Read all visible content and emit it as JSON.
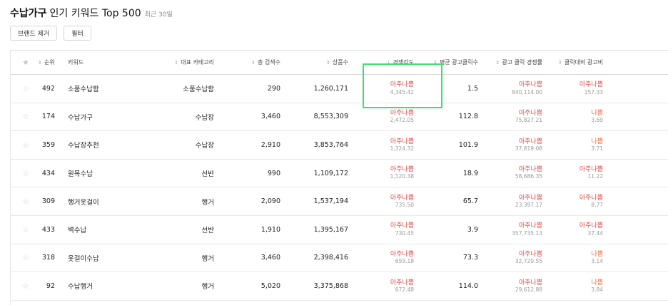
{
  "header": {
    "title_bold": "수납가구",
    "title_rest": "인기 키워드 Top 500",
    "period": "최근 30일"
  },
  "toolbar": {
    "brand_remove": "브랜드 제거",
    "filter": "필터"
  },
  "columns": {
    "star": "★",
    "rank": "순위",
    "keyword": "키워드",
    "category": "대표 카테고리",
    "search_volume": "총 검색수",
    "product_count": "상품수",
    "competition": "경쟁강도",
    "avg_ad_clicks": "평균 광고클릭수",
    "ad_click_competition": "광고 클릭 경쟁률",
    "click_cost": "클릭대비 광고비"
  },
  "icons": {
    "star": "star-outline-icon",
    "sort": "sort-arrows-icon"
  },
  "colors": {
    "very_bad": "#e14b4b",
    "bad": "#f06a3c",
    "highlight": "#3ee06b"
  },
  "rows": [
    {
      "rank": "492",
      "keyword": "소품수납함",
      "category": "소품수납함",
      "volume": "290",
      "products": "1,260,171",
      "comp_label": "아주나쁨",
      "comp_value": "4,345.42",
      "avg_clicks": "1.5",
      "adc_label": "아주나쁨",
      "adc_value": "840,114.00",
      "cost_label": "아주나쁨",
      "cost_value": "157.33",
      "cost_level": "very-bad"
    },
    {
      "rank": "174",
      "keyword": "수납가구",
      "category": "수납장",
      "volume": "3,460",
      "products": "8,553,309",
      "comp_label": "아주나쁨",
      "comp_value": "2,472.05",
      "avg_clicks": "112.8",
      "adc_label": "아주나쁨",
      "adc_value": "75,827.21",
      "cost_label": "나쁨",
      "cost_value": "3.69",
      "cost_level": "bad"
    },
    {
      "rank": "359",
      "keyword": "수납장추천",
      "category": "수납장",
      "volume": "2,910",
      "products": "3,853,764",
      "comp_label": "아주나쁨",
      "comp_value": "1,324.32",
      "avg_clicks": "101.9",
      "adc_label": "아주나쁨",
      "adc_value": "37,819.08",
      "cost_label": "나쁨",
      "cost_value": "3.71",
      "cost_level": "bad"
    },
    {
      "rank": "434",
      "keyword": "원목수납",
      "category": "선반",
      "volume": "990",
      "products": "1,109,172",
      "comp_label": "아주나쁨",
      "comp_value": "1,120.38",
      "avg_clicks": "18.9",
      "adc_label": "아주나쁨",
      "adc_value": "58,686.35",
      "cost_label": "아주나쁨",
      "cost_value": "11.22",
      "cost_level": "very-bad"
    },
    {
      "rank": "309",
      "keyword": "행거옷걸이",
      "category": "행거",
      "volume": "2,090",
      "products": "1,537,194",
      "comp_label": "아주나쁨",
      "comp_value": "735.50",
      "avg_clicks": "65.7",
      "adc_label": "아주나쁨",
      "adc_value": "23,397.17",
      "cost_label": "아주나쁨",
      "cost_value": "8.77",
      "cost_level": "very-bad"
    },
    {
      "rank": "433",
      "keyword": "벽수납",
      "category": "선반",
      "volume": "1,910",
      "products": "1,395,167",
      "comp_label": "아주나쁨",
      "comp_value": "730.45",
      "avg_clicks": "3.9",
      "adc_label": "아주나쁨",
      "adc_value": "357,735.13",
      "cost_label": "아주나쁨",
      "cost_value": "37.44",
      "cost_level": "very-bad"
    },
    {
      "rank": "318",
      "keyword": "옷걸이수납",
      "category": "행거",
      "volume": "3,460",
      "products": "2,398,416",
      "comp_label": "아주나쁨",
      "comp_value": "693.18",
      "avg_clicks": "73.3",
      "adc_label": "아주나쁨",
      "adc_value": "32,720.55",
      "cost_label": "나쁨",
      "cost_value": "3.14",
      "cost_level": "bad"
    },
    {
      "rank": "92",
      "keyword": "수납행거",
      "category": "행거",
      "volume": "5,020",
      "products": "3,375,868",
      "comp_label": "아주나쁨",
      "comp_value": "672.48",
      "avg_clicks": "114.0",
      "adc_label": "아주나쁨",
      "adc_value": "29,612.88",
      "cost_label": "나쁨",
      "cost_value": "3.84",
      "cost_level": "bad"
    }
  ]
}
